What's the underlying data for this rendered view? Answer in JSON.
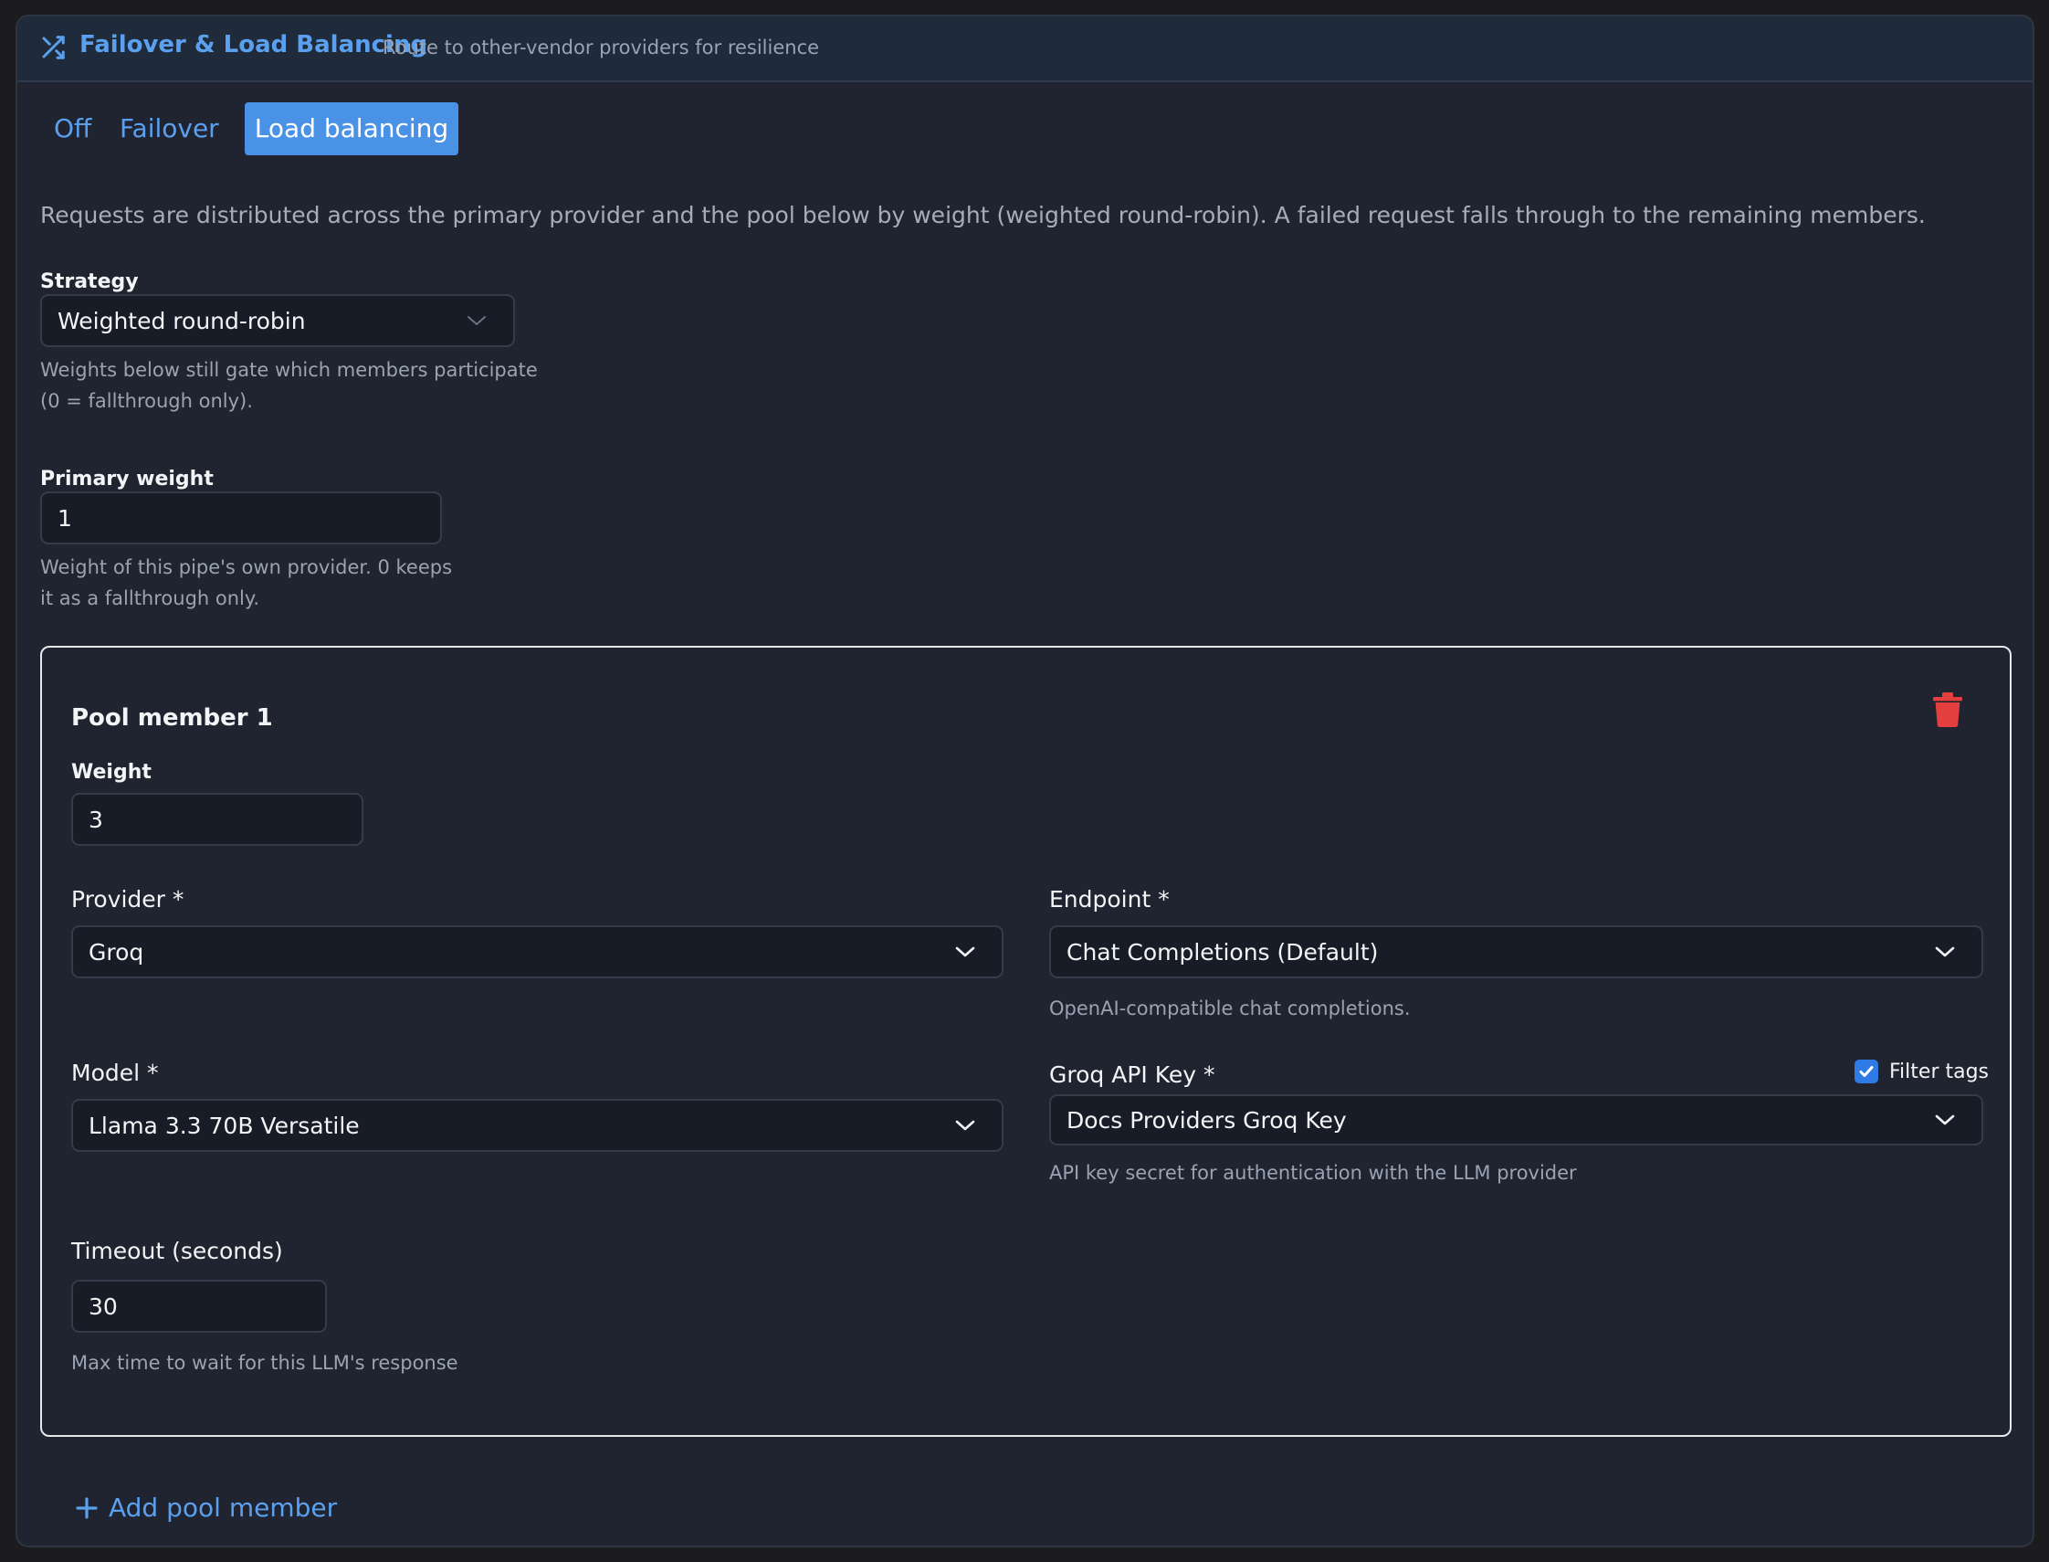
{
  "header": {
    "icon": "shuffle-icon",
    "title": "Failover & Load Balancing",
    "subtitle": "Route to other-vendor providers for resilience"
  },
  "mode_tabs": {
    "items": [
      "Off",
      "Failover",
      "Load balancing"
    ],
    "selected": "Load balancing"
  },
  "description": "Requests are distributed across the primary provider and the pool below by weight (weighted round-robin). A failed request falls through to the remaining members.",
  "strategy": {
    "label": "Strategy",
    "value": "Weighted round-robin",
    "help_line1": "Weights below still gate which members participate",
    "help_line2": "(0 = fallthrough only)."
  },
  "primary_weight": {
    "label": "Primary weight",
    "value": "1",
    "help_line1": "Weight of this pipe's own provider. 0 keeps",
    "help_line2": "it as a fallthrough only."
  },
  "pool_member": {
    "title": "Pool member 1",
    "delete_icon": "trash-icon",
    "weight_label": "Weight",
    "weight_value": "3",
    "provider_label": "Provider *",
    "provider_value": "Groq",
    "endpoint_label": "Endpoint *",
    "endpoint_value": "Chat Completions (Default)",
    "endpoint_help": "OpenAI-compatible chat completions.",
    "model_label": "Model *",
    "model_value": "Llama 3.3 70B Versatile",
    "api_key_label": "Groq API Key *",
    "filter_tags_label": "Filter tags",
    "filter_tags_checked": true,
    "api_key_value": "Docs Providers Groq Key",
    "api_key_help": "API key secret for authentication with the LLM provider",
    "timeout_label": "Timeout (seconds)",
    "timeout_value": "30",
    "timeout_help": "Max time to wait for this LLM's response"
  },
  "add_button": "Add pool member",
  "colors": {
    "accent": "#5ba0ee",
    "selected_tab": "#4a92e6",
    "danger": "#e53e3e",
    "panel": "#1f2430"
  }
}
